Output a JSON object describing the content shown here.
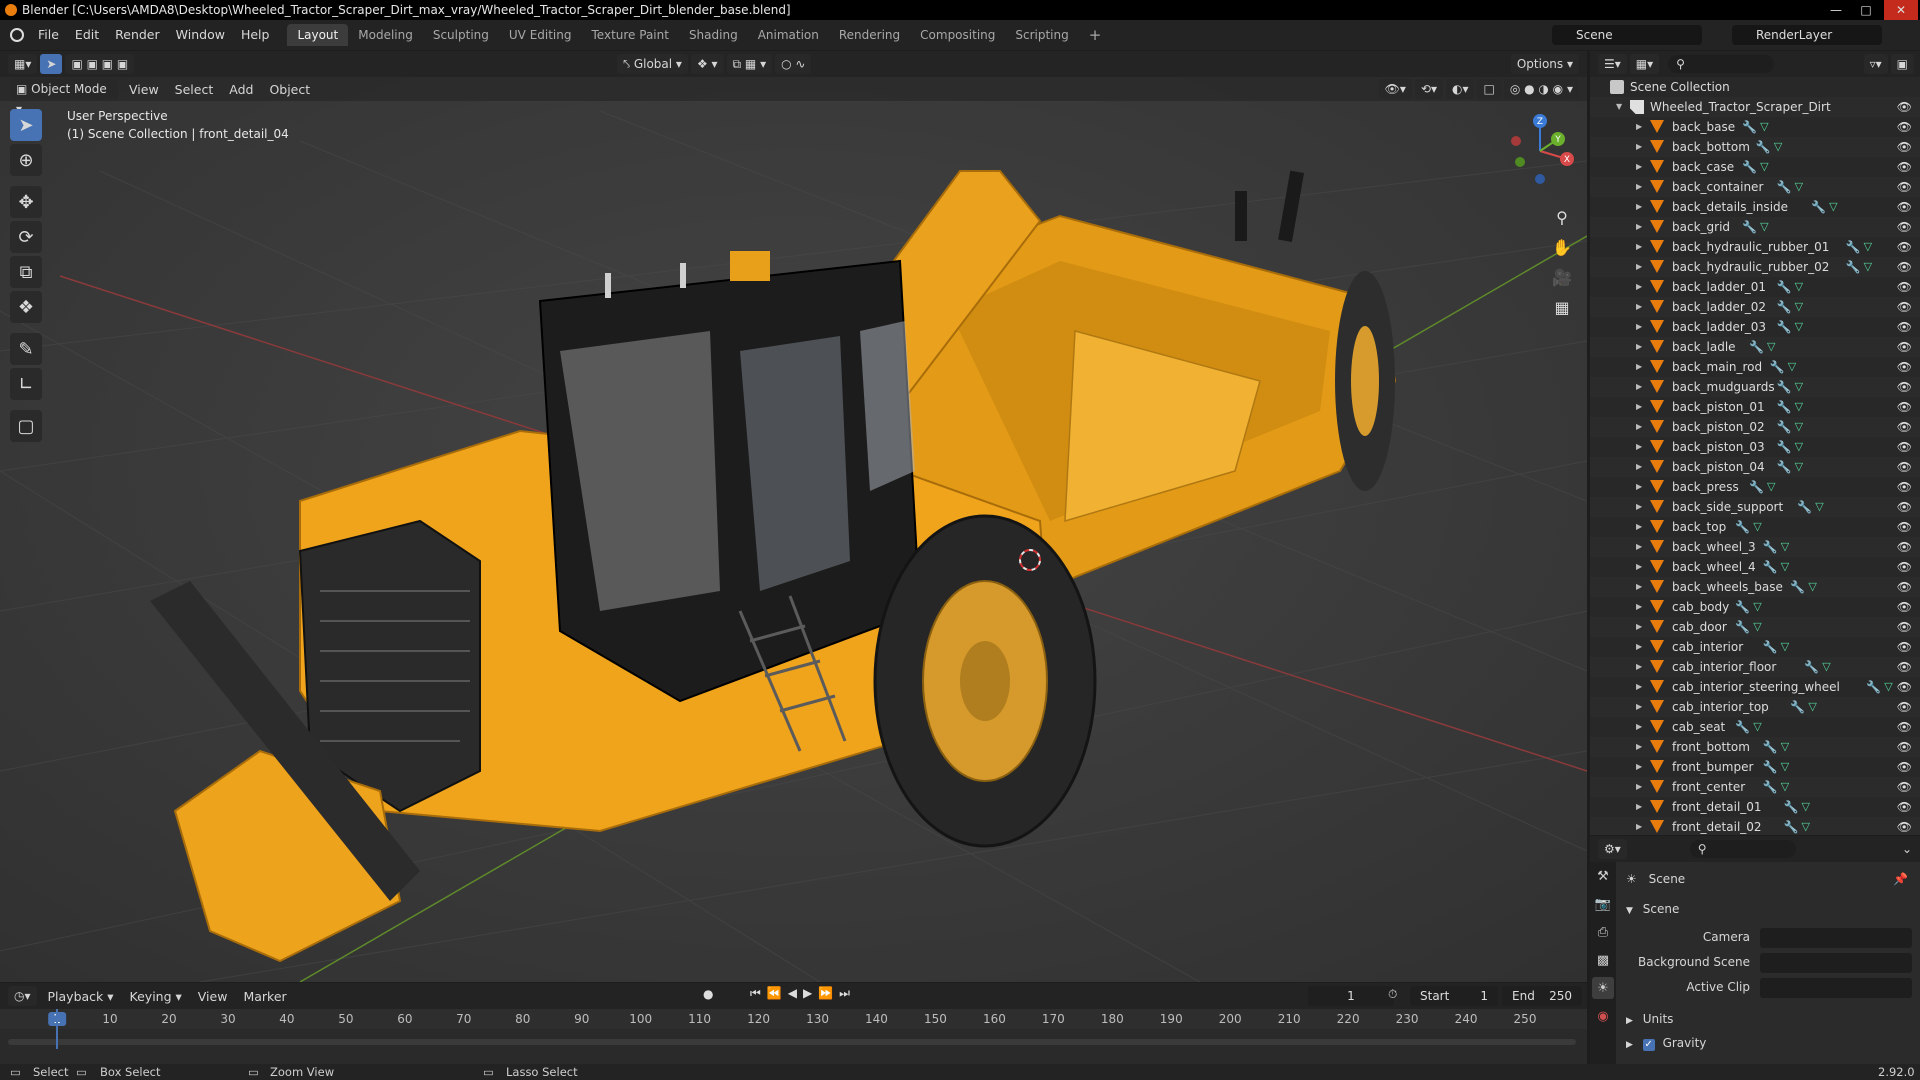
{
  "window": {
    "title": "Blender [C:\\Users\\AMDA8\\Desktop\\Wheeled_Tractor_Scraper_Dirt_max_vray/Wheeled_Tractor_Scraper_Dirt_blender_base.blend]"
  },
  "menu": [
    "File",
    "Edit",
    "Render",
    "Window",
    "Help"
  ],
  "workspaces": [
    "Layout",
    "Modeling",
    "Sculpting",
    "UV Editing",
    "Texture Paint",
    "Shading",
    "Animation",
    "Rendering",
    "Compositing",
    "Scripting"
  ],
  "active_workspace": "Layout",
  "top_right": {
    "scene": "Scene",
    "view_layer": "RenderLayer"
  },
  "viewport": {
    "transform_orientation": "Global",
    "options_label": "Options",
    "mode": "Object Mode",
    "header_menus": [
      "View",
      "Select",
      "Add",
      "Object"
    ],
    "perspective_label": "User Perspective",
    "collection_label": "(1) Scene Collection | front_detail_04",
    "gizmo_axes": {
      "x": "X",
      "y": "Y",
      "z": "Z"
    }
  },
  "outliner": {
    "root": "Scene Collection",
    "collection": "Wheeled_Tractor_Scraper_Dirt",
    "objects": [
      "back_base",
      "back_bottom",
      "back_case",
      "back_container",
      "back_details_inside",
      "back_grid",
      "back_hydraulic_rubber_01",
      "back_hydraulic_rubber_02",
      "back_ladder_01",
      "back_ladder_02",
      "back_ladder_03",
      "back_ladle",
      "back_main_rod",
      "back_mudguards",
      "back_piston_01",
      "back_piston_02",
      "back_piston_03",
      "back_piston_04",
      "back_press",
      "back_side_support",
      "back_top",
      "back_wheel_3",
      "back_wheel_4",
      "back_wheels_base",
      "cab_body",
      "cab_door",
      "cab_interior",
      "cab_interior_floor",
      "cab_interior_steering_wheel",
      "cab_interior_top",
      "cab_seat",
      "front_bottom",
      "front_bumper",
      "front_center",
      "front_detail_01",
      "front_detail_02"
    ]
  },
  "properties": {
    "breadcrumb": "Scene",
    "panel": "Scene",
    "fields": {
      "camera": "Camera",
      "background_scene": "Background Scene",
      "active_clip": "Active Clip"
    },
    "subpanels": {
      "units": "Units",
      "gravity": "Gravity"
    },
    "gravity_checked": true
  },
  "timeline": {
    "menus": [
      "Playback",
      "Keying",
      "View",
      "Marker"
    ],
    "current_frame": "1",
    "start_label": "Start",
    "start": "1",
    "end_label": "End",
    "end": "250",
    "ticks": [
      "1",
      "10",
      "20",
      "30",
      "40",
      "50",
      "60",
      "70",
      "80",
      "90",
      "100",
      "110",
      "120",
      "130",
      "140",
      "150",
      "160",
      "170",
      "180",
      "190",
      "200",
      "210",
      "220",
      "230",
      "240",
      "250"
    ]
  },
  "statusbar": {
    "select": "Select",
    "box_select": "Box Select",
    "zoom_view": "Zoom View",
    "lasso_select": "Lasso Select",
    "version": "2.92.0"
  },
  "colors": {
    "accent": "#4772b3",
    "machine_yellow": "#f2a61c",
    "object_orange": "#e87d0d",
    "mesh_green": "#54d69b"
  }
}
